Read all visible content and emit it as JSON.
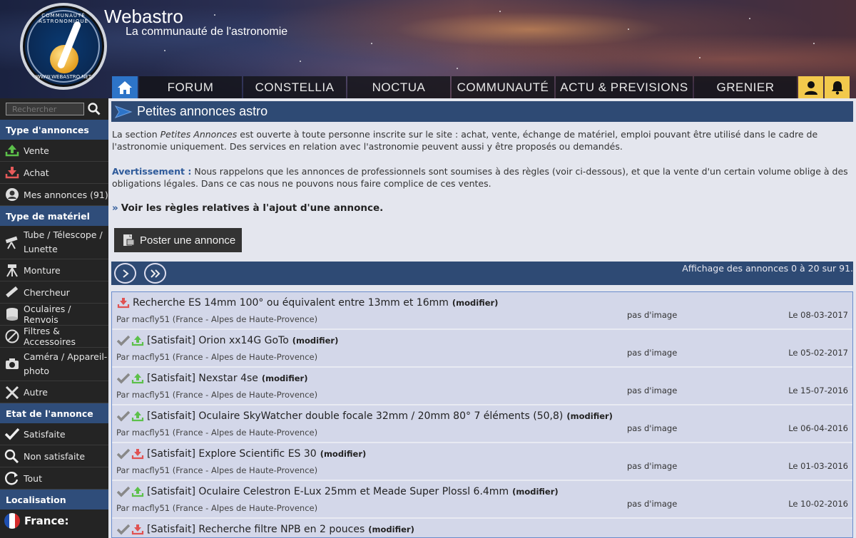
{
  "site": {
    "title": "Webastro",
    "subtitle": "La communauté de l'astronomie",
    "logo_text": "COMMUNAUTÉ ASTRONOMIQUE",
    "logo_url": "WWW.WEBASTRO.NET"
  },
  "nav": {
    "items": [
      {
        "label": "FORUM"
      },
      {
        "label": "CONSTELLIA"
      },
      {
        "label": "NOCTUA"
      },
      {
        "label": "COMMUNAUTÉ"
      },
      {
        "label": "ACTU & PREVISIONS"
      },
      {
        "label": "GRENIER"
      }
    ]
  },
  "sidebar": {
    "search_placeholder": "Rechercher",
    "section_type_annonces": "Type d'annonces",
    "type_annonces": [
      {
        "label": "Vente",
        "icon": "upload-arrow-icon"
      },
      {
        "label": "Achat",
        "icon": "download-arrow-icon"
      },
      {
        "label": "Mes annonces (91)",
        "icon": "user-circle-icon"
      }
    ],
    "section_type_materiel": "Type de matériel",
    "type_materiel": [
      {
        "label": "Tube / Télescope / Lunette",
        "icon": "telescope-icon"
      },
      {
        "label": "Monture",
        "icon": "mount-icon"
      },
      {
        "label": "Chercheur",
        "icon": "finder-icon"
      },
      {
        "label": "Oculaires / Renvois",
        "icon": "eyepiece-icon"
      },
      {
        "label": "Filtres & Accessoires",
        "icon": "filter-icon"
      },
      {
        "label": "Caméra / Appareil-photo",
        "icon": "camera-icon"
      },
      {
        "label": "Autre",
        "icon": "tools-icon"
      }
    ],
    "section_etat": "Etat de l'annonce",
    "etat": [
      {
        "label": "Satisfaite",
        "icon": "check-icon"
      },
      {
        "label": "Non satisfaite",
        "icon": "search-icon"
      },
      {
        "label": "Tout",
        "icon": "refresh-icon"
      }
    ],
    "section_localisation": "Localisation",
    "country": "France:"
  },
  "main": {
    "title": "Petites annonces astro",
    "intro_part1": "La section ",
    "intro_em": "Petites Annonces",
    "intro_part2": " est ouverte à toute personne inscrite sur le site : achat, vente, échange de matériel, emploi pouvant être utilisé dans le cadre de l'astronomie uniquement. Des services en relation avec l'astronomie peuvent aussi y être proposés ou demandés.",
    "warn_label": "Avertissement :",
    "warn_text": " Nous rappelons que les annonces de professionnels sont soumises à des règles (voir ci-dessous), et que la vente d'un certain volume oblige à des obligations légales. Dans ce cas nous ne pouvons nous faire complice de ces ventes.",
    "rules_arrow": "»",
    "rules_link": "Voir les règles relatives à l'ajout d'une annonce.",
    "post_button": "Poster une annonce",
    "pager_info": "Affichage des annonces 0 à 20 sur 91."
  },
  "listings": [
    {
      "title": "Recherche ES 14mm 100° ou équivalent entre 13mm et 16mm",
      "modify": "(modifier)",
      "by": "Par macfly51 (France - Alpes de Haute-Provence)",
      "image": "pas d'image",
      "date": "Le 08-03-2017",
      "type": "achat",
      "satisfied": false
    },
    {
      "title": "[Satisfait] Orion xx14G GoTo",
      "modify": "(modifier)",
      "by": "Par macfly51 (France - Alpes de Haute-Provence)",
      "image": "pas d'image",
      "date": "Le 05-02-2017",
      "type": "vente",
      "satisfied": true
    },
    {
      "title": "[Satisfait] Nexstar 4se",
      "modify": "(modifier)",
      "by": "Par macfly51 (France - Alpes de Haute-Provence)",
      "image": "pas d'image",
      "date": "Le 15-07-2016",
      "type": "vente",
      "satisfied": true
    },
    {
      "title": "[Satisfait] Oculaire SkyWatcher double focale 32mm / 20mm 80° 7 éléments (50,8)",
      "modify": "(modifier)",
      "by": "Par macfly51 (France - Alpes de Haute-Provence)",
      "image": "pas d'image",
      "date": "Le 06-04-2016",
      "type": "vente",
      "satisfied": true
    },
    {
      "title": "[Satisfait] Explore Scientific ES 30",
      "modify": "(modifier)",
      "by": "Par macfly51 (France - Alpes de Haute-Provence)",
      "image": "pas d'image",
      "date": "Le 01-03-2016",
      "type": "achat",
      "satisfied": true
    },
    {
      "title": "[Satisfait] Oculaire Celestron E-Lux 25mm et Meade Super Plossl 6.4mm",
      "modify": "(modifier)",
      "by": "Par macfly51 (France - Alpes de Haute-Provence)",
      "image": "pas d'image",
      "date": "Le 10-02-2016",
      "type": "vente",
      "satisfied": true
    },
    {
      "title": "[Satisfait] Recherche filtre NPB en 2 pouces",
      "modify": "(modifier)",
      "by": "",
      "image": "",
      "date": "",
      "type": "achat",
      "satisfied": true
    }
  ],
  "colors": {
    "accent": "#2e4a74",
    "vente": "#4caf3a",
    "achat": "#e05252",
    "home": "#2d74c8",
    "user_btn": "#f2c94c"
  }
}
